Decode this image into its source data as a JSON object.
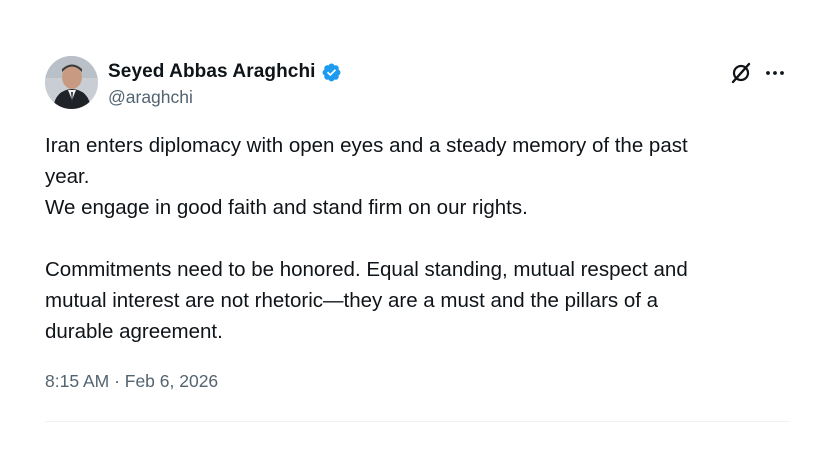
{
  "author": {
    "display_name": "Seyed Abbas Araghchi",
    "handle": "@araghchi",
    "verified_icon": "verified-badge-icon",
    "avatar_icon": "profile-photo"
  },
  "actions": {
    "grok_icon": "grok-icon",
    "more_icon": "more-options-icon"
  },
  "tweet": {
    "paragraph1_line1": "Iran enters diplomacy with open eyes and a steady memory of the past",
    "paragraph1_line2": "year.",
    "paragraph1_line3": "We engage in good faith and stand firm on our rights.",
    "paragraph2_line1": "Commitments need to be honored. Equal standing, mutual respect and",
    "paragraph2_line2": "mutual interest are not rhetoric—they are a must and the pillars of a",
    "paragraph2_line3": "durable agreement."
  },
  "meta": {
    "timestamp": "8:15 AM · Feb 6, 2026"
  },
  "colors": {
    "text": "#0f1419",
    "secondary": "#536471",
    "verified": "#1d9bf0",
    "divider": "#eff3f4"
  }
}
